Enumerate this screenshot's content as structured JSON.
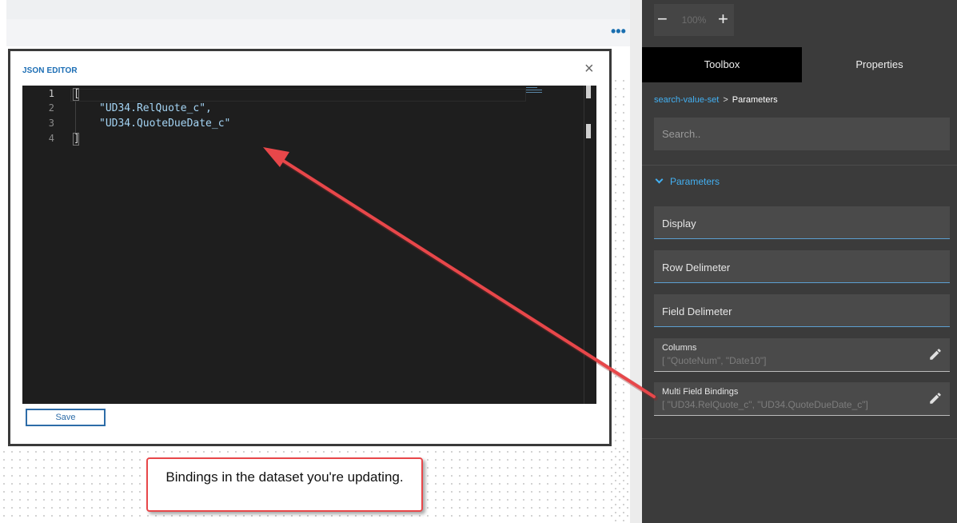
{
  "canvas": {
    "more_icon": "more-horizontal-icon"
  },
  "modal": {
    "title": "JSON EDITOR",
    "close_glyph": "×",
    "close_icon": "close-icon",
    "save_label": "Save",
    "editor": {
      "lines": [
        {
          "number": "1",
          "text": "["
        },
        {
          "number": "2",
          "text": "\"UD34.RelQuote_c\","
        },
        {
          "number": "3",
          "text": "\"UD34.QuoteDueDate_c\""
        },
        {
          "number": "4",
          "text": "]"
        }
      ]
    }
  },
  "callout": {
    "text": "Bindings in the dataset you're updating."
  },
  "panel": {
    "zoom": {
      "minus": "−",
      "value": "100%",
      "plus": "+"
    },
    "tabs": [
      {
        "label": "Toolbox",
        "active": true
      },
      {
        "label": "Properties",
        "active": false
      }
    ],
    "breadcrumb": {
      "parent": "search-value-set",
      "separator": ">",
      "current": "Parameters"
    },
    "search_placeholder": "Search..",
    "section_title": "Parameters",
    "fields": [
      {
        "label": "Display"
      },
      {
        "label": "Row Delimeter"
      },
      {
        "label": "Field Delimeter"
      }
    ],
    "columns": {
      "label": "Columns",
      "value": "[  \"QuoteNum\", \"Date10\"]"
    },
    "multi_bindings": {
      "label": "Multi Field Bindings",
      "value": "[  \"UD34.RelQuote_c\", \"UD34.QuoteDueDate_c\"]"
    }
  },
  "colors": {
    "accent_blue": "#43b0f2",
    "callout_border": "#e8474a",
    "arrow": "#e8474a",
    "panel_bg": "#3b3b3b",
    "editor_bg": "#1e1e1e"
  }
}
